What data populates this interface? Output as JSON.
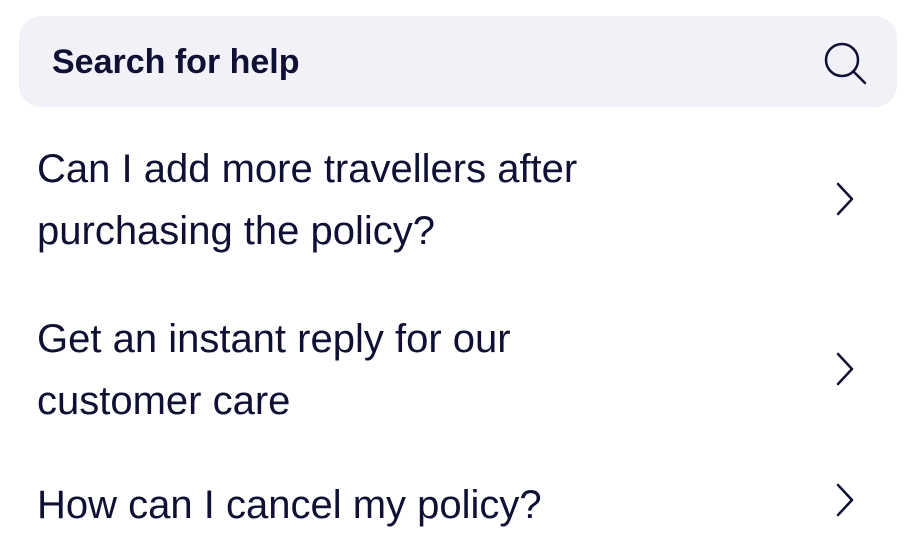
{
  "search": {
    "placeholder": "Search for help",
    "icon": "search-icon"
  },
  "faq": {
    "items": [
      {
        "line1": "Can I add more travellers after",
        "line2": "purchasing the policy?",
        "icon": "chevron-right-icon"
      },
      {
        "line1": "Get an instant reply for our",
        "line2": "customer care",
        "icon": "chevron-right-icon"
      },
      {
        "line1": "How can I cancel my policy?",
        "line2": "",
        "icon": "chevron-right-icon"
      }
    ]
  },
  "colors": {
    "text": "#0f1033",
    "search_background": "#f1f1f7"
  }
}
